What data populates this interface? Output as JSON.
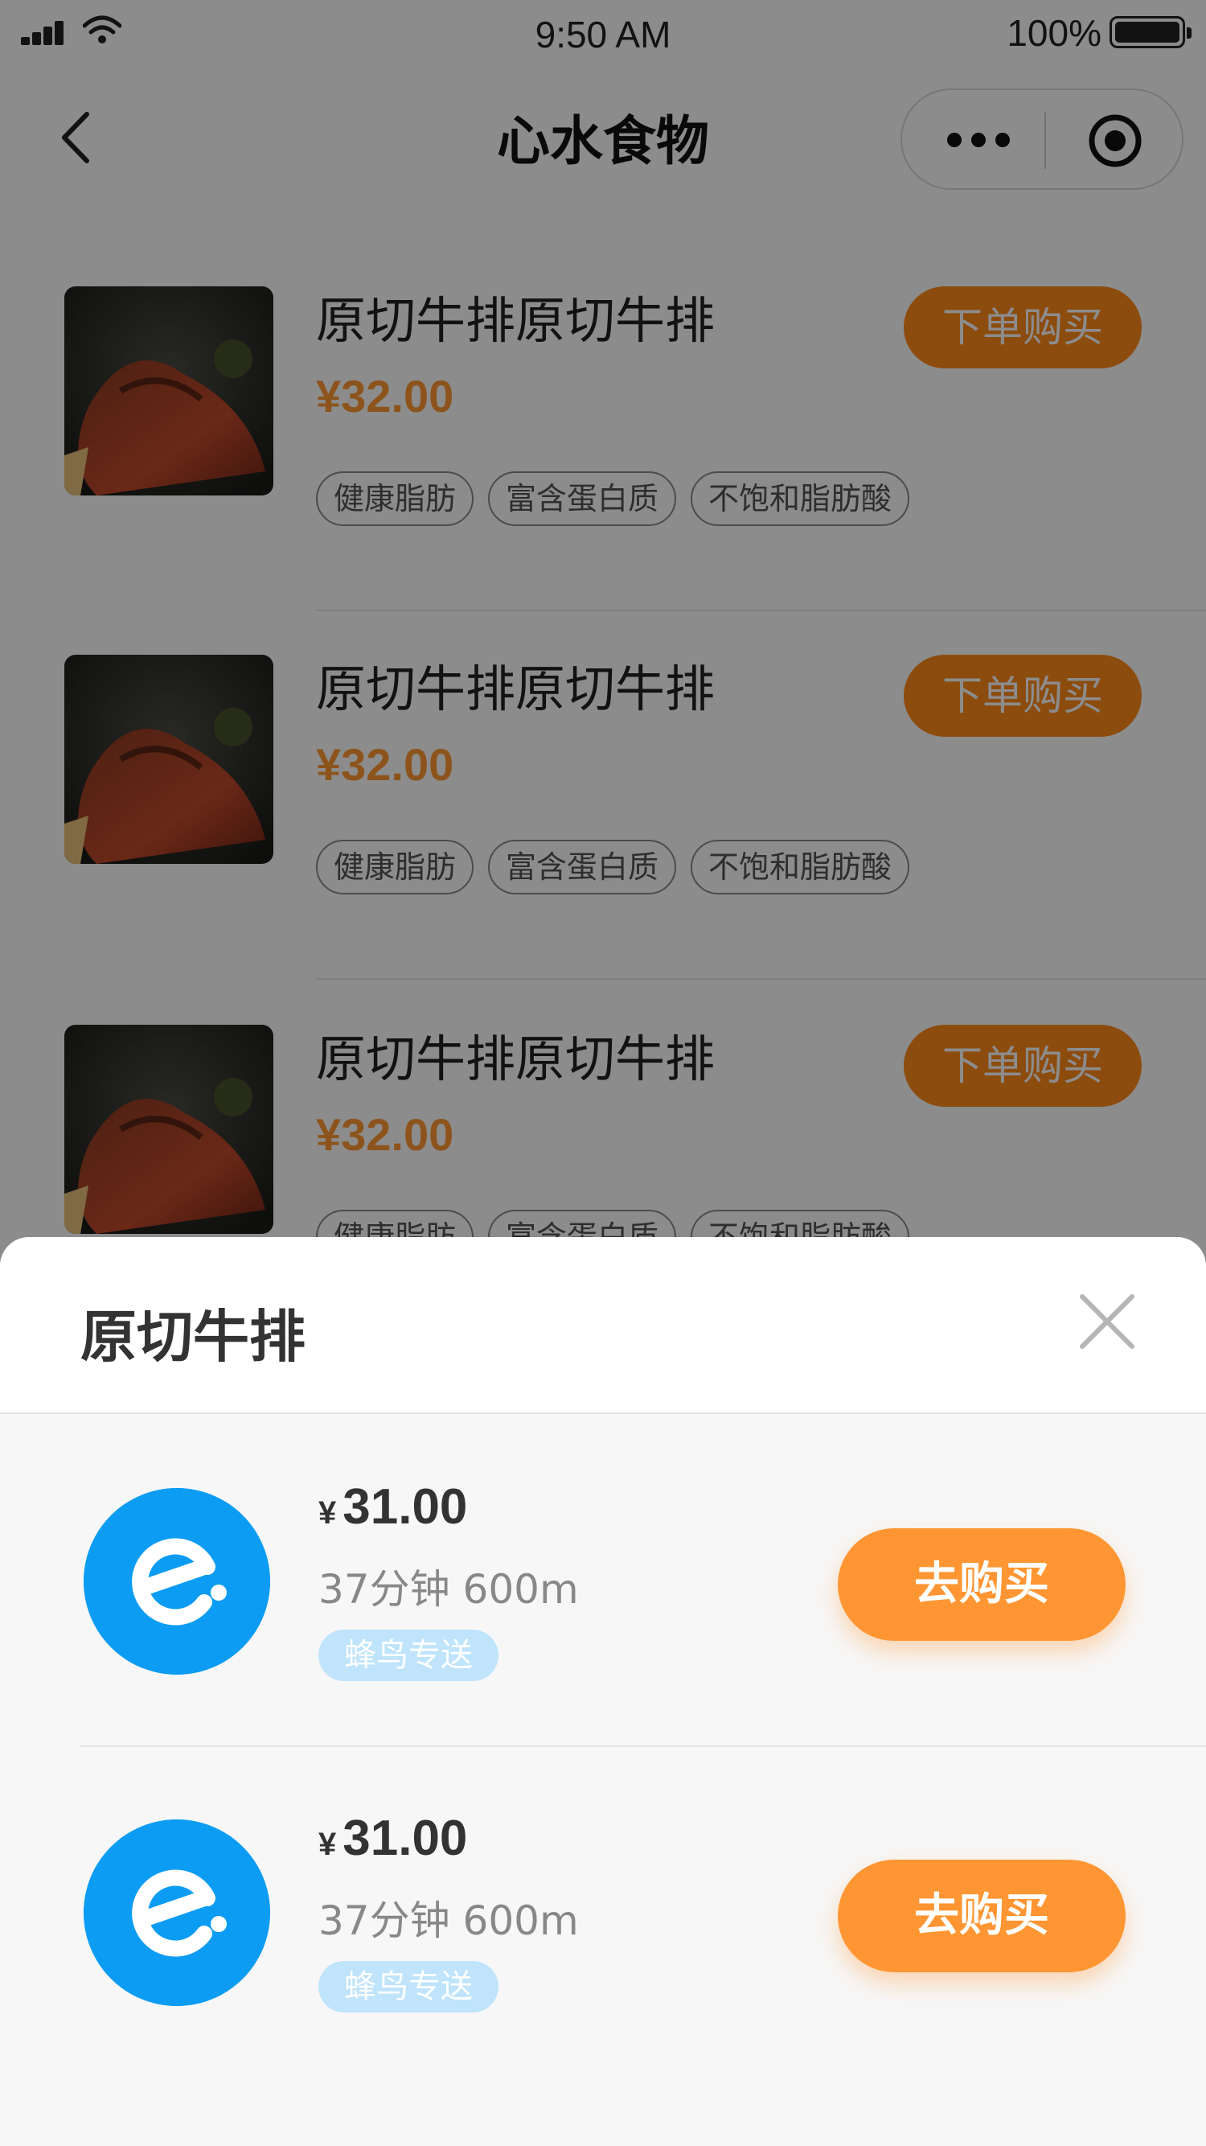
{
  "status_bar": {
    "time": "9:50 AM",
    "battery": "100%"
  },
  "nav": {
    "title": "心水食物"
  },
  "products": [
    {
      "name": "原切牛排原切牛排",
      "price": "¥32.00",
      "buy_label": "下单购买",
      "tags": [
        "健康脂肪",
        "富含蛋白质",
        "不饱和脂肪酸"
      ]
    },
    {
      "name": "原切牛排原切牛排",
      "price": "¥32.00",
      "buy_label": "下单购买",
      "tags": [
        "健康脂肪",
        "富含蛋白质",
        "不饱和脂肪酸"
      ]
    },
    {
      "name": "原切牛排原切牛排",
      "price": "¥32.00",
      "buy_label": "下单购买",
      "tags": [
        "健康脂肪",
        "富含蛋白质",
        "不饱和脂肪酸"
      ]
    }
  ],
  "sheet": {
    "title": "原切牛排",
    "stores": [
      {
        "currency": "¥",
        "price": "31.00",
        "meta": "37分钟 600m",
        "badge": "蜂鸟专送",
        "button": "去购买"
      },
      {
        "currency": "¥",
        "price": "31.00",
        "meta": "37分钟 600m",
        "badge": "蜂鸟专送",
        "button": "去购买"
      }
    ]
  },
  "colors": {
    "accent_orange": "#ff9633",
    "brand_blue": "#0c9cf3",
    "badge_blue": "#bfe4fb",
    "price_orange": "#ff9933"
  },
  "icons": {
    "back": "chevron-left-icon",
    "more": "more-dots-icon",
    "close_program": "target-icon",
    "close_sheet": "close-icon",
    "store_logo": "eleme-logo-icon"
  }
}
